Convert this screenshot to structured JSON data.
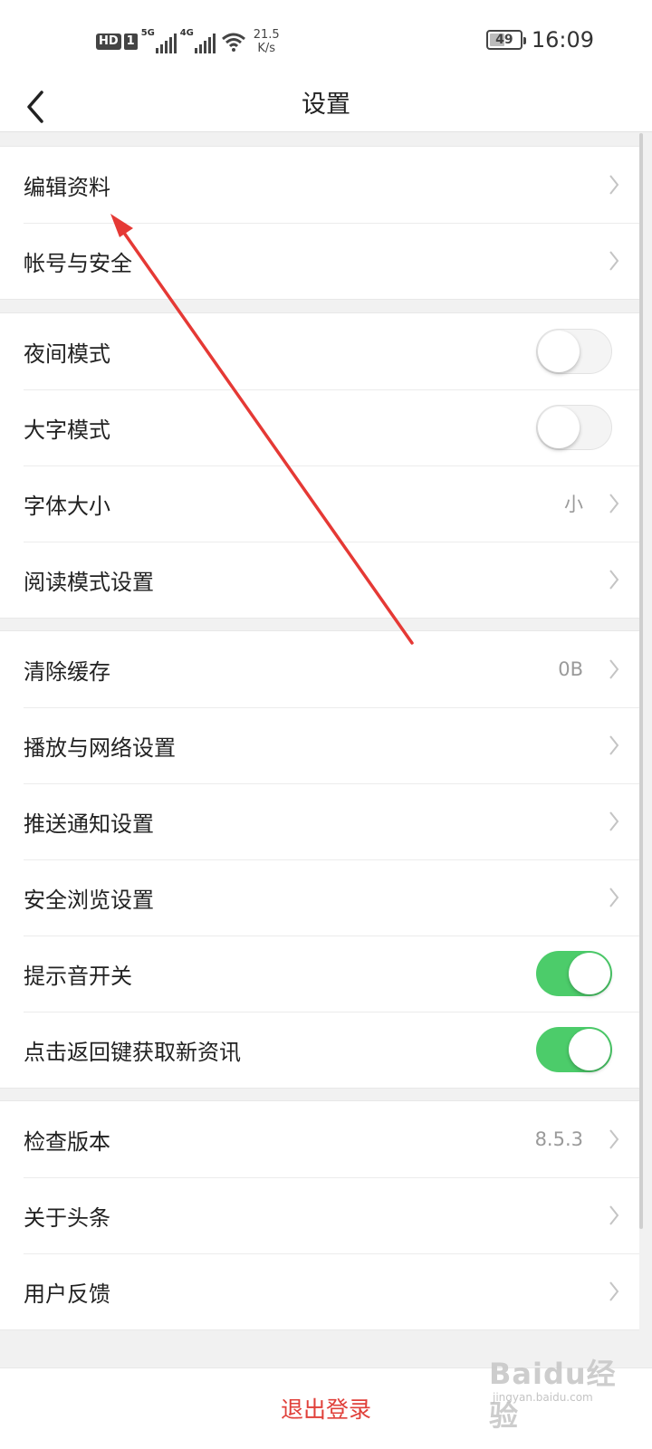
{
  "status_bar": {
    "hd_label": "HD",
    "sim_label": "1",
    "net_gen_1": "5G",
    "net_gen_2": "4G",
    "net_speed_value": "21.5",
    "net_speed_unit": "K/s",
    "battery": "49",
    "time": "16:09"
  },
  "header": {
    "title": "设置",
    "back_icon": "chevron-left-icon"
  },
  "groups": [
    {
      "items": [
        {
          "label": "编辑资料",
          "kind": "nav"
        },
        {
          "label": "帐号与安全",
          "kind": "nav"
        }
      ]
    },
    {
      "items": [
        {
          "label": "夜间模式",
          "kind": "toggle",
          "on": false
        },
        {
          "label": "大字模式",
          "kind": "toggle",
          "on": false
        },
        {
          "label": "字体大小",
          "kind": "nav",
          "value": "小"
        },
        {
          "label": "阅读模式设置",
          "kind": "nav"
        }
      ]
    },
    {
      "items": [
        {
          "label": "清除缓存",
          "kind": "nav",
          "value": "0B"
        },
        {
          "label": "播放与网络设置",
          "kind": "nav"
        },
        {
          "label": "推送通知设置",
          "kind": "nav"
        },
        {
          "label": "安全浏览设置",
          "kind": "nav"
        },
        {
          "label": "提示音开关",
          "kind": "toggle",
          "on": true
        },
        {
          "label": "点击返回键获取新资讯",
          "kind": "toggle",
          "on": true
        }
      ]
    },
    {
      "items": [
        {
          "label": "检查版本",
          "kind": "nav",
          "value": "8.5.3"
        },
        {
          "label": "关于头条",
          "kind": "nav"
        },
        {
          "label": "用户反馈",
          "kind": "nav"
        }
      ]
    }
  ],
  "logout": {
    "label": "退出登录"
  },
  "watermark": {
    "text": "Baidu经验",
    "sub": "jingyan.baidu.com"
  },
  "colors": {
    "toggle_on": "#4ccc6a",
    "logout_text": "#e0403a",
    "annotation_arrow": "#e53935"
  }
}
